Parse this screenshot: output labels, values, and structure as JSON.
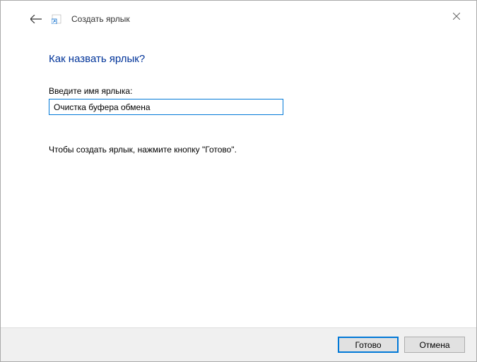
{
  "header": {
    "window_title": "Создать ярлык"
  },
  "content": {
    "heading": "Как назвать ярлык?",
    "field_label": "Введите имя ярлыка:",
    "input_value": "Очистка буфера обмена",
    "instruction": "Чтобы создать ярлык, нажмите кнопку \"Готово\"."
  },
  "footer": {
    "primary_button": "Готово",
    "cancel_button": "Отмена"
  }
}
